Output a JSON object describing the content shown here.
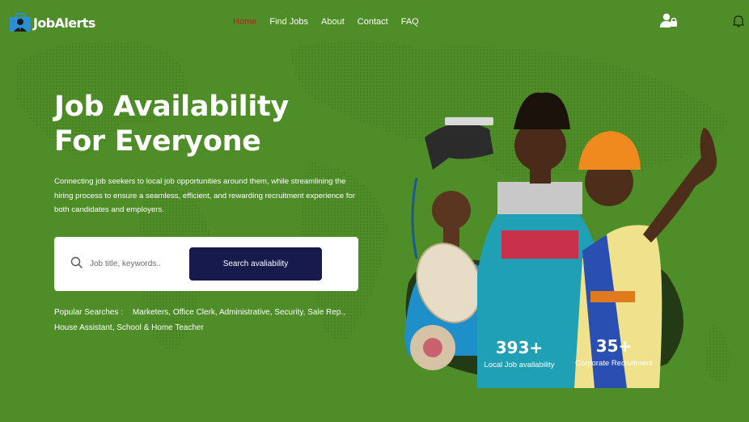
{
  "brand": {
    "name": "JobAlerts",
    "accent": "#4e8d28",
    "dark": "#161a4d",
    "active_nav": "#b4241b"
  },
  "nav": {
    "items": [
      {
        "label": "Home",
        "active": true
      },
      {
        "label": "Find Jobs"
      },
      {
        "label": "About"
      },
      {
        "label": "Contact"
      },
      {
        "label": "FAQ"
      }
    ]
  },
  "header_icons": {
    "account": "user-lock-icon",
    "notifications": "bell-icon"
  },
  "hero": {
    "title_line1": "Job Availability",
    "title_line2": "For Everyone",
    "description": "Connecting job seekers to local job opportunities around them, while streamlining the hiring process to ensure a seamless, efficient, and rewarding recruitment experience for both candidates and employers."
  },
  "search": {
    "placeholder": "Job title, keywords..",
    "value": "",
    "button_label": "Search avaliability"
  },
  "popular": {
    "label": "Popular Searches :",
    "tags": [
      "Marketers,",
      "Office Clerk,",
      "Administrative,",
      "Security,",
      "Sale Rep.,",
      "House Assistant,",
      "School & Home Teacher"
    ]
  },
  "stats": [
    {
      "value": "393+",
      "label": "Local Job availability"
    },
    {
      "value": "35+",
      "label": "Corporate Recruitment"
    }
  ]
}
